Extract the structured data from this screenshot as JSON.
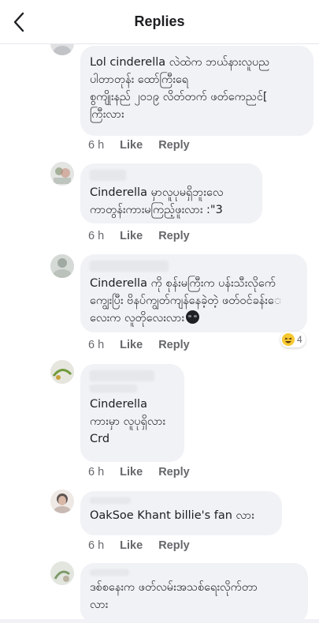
{
  "header": {
    "title": "Replies"
  },
  "actions": {
    "like": "Like",
    "reply": "Reply"
  },
  "comments": [
    {
      "text": "Lol cinderella လဲထဲက ဘယ်နားလူပည\nပါတာတုန်း ထော်ကြီးရေ\nစွကျိုးနည် ၂၀၁၉ လိတ်တက် ဖတ်ကေညင်[\nကြီးလား",
      "time": "6 h"
    },
    {
      "text": "Cinderella မှာလူပုမရှိဘူးလေ\nကာတွန်းကားမကြည့်ဖူးလား :\"3",
      "time": "6 h"
    },
    {
      "text": "Cinderella ကို စုန်းမကြီးက ပန်းသီးလိုက်ေ\nကျွေးပြီး ဗိနပ်ကျွတ်ကျန်နေခဲ့တဲ့ ဖတ်ဝင်ခန်းေ\nလေးက လူတိုလေးလား",
      "time": "6 h",
      "reaction": {
        "emoji": "laughing-emoji",
        "count": "4"
      }
    },
    {
      "text": "Cinderella\nကားမှာ လူပုရှိလား\nCrd",
      "time": "6 h"
    },
    {
      "text": "OakSoe Khant billie's fan လား",
      "time": "6 h"
    },
    {
      "text": "ဒစ်စနေးက ဖတ်လမ်းအသစ်ရေးလိုက်တာ\nလား"
    }
  ],
  "colors": {
    "bubble": "#f0f2f5",
    "meta": "#65676b",
    "text": "#1c1e21"
  }
}
